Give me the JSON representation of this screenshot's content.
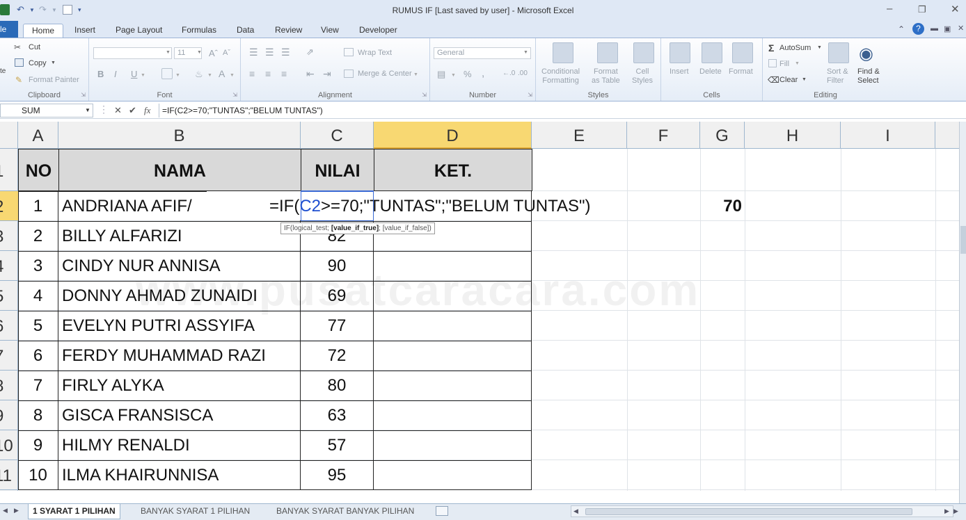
{
  "window": {
    "title": "RUMUS IF [Last saved by user]  -  Microsoft Excel",
    "minimize": "–",
    "restore": "❐",
    "close": "✕"
  },
  "ribbon_tabs": {
    "file": "le",
    "home": "Home",
    "insert": "Insert",
    "page_layout": "Page Layout",
    "formulas": "Formulas",
    "data": "Data",
    "review": "Review",
    "view": "View",
    "developer": "Developer"
  },
  "clipboard": {
    "cut": "Cut",
    "copy": "Copy",
    "format_painter": "Format Painter",
    "paste": "te",
    "label": "Clipboard"
  },
  "font": {
    "size": "11",
    "bold": "B",
    "italic": "I",
    "underline": "U",
    "label": "Font"
  },
  "alignment": {
    "wrap_text": "Wrap Text",
    "merge_center": "Merge & Center",
    "label": "Alignment"
  },
  "number": {
    "format": "General",
    "percent": "%",
    "label": "Number"
  },
  "styles": {
    "conditional_formatting": "Conditional\nFormatting",
    "format_as_table": "Format\nas Table",
    "cell_styles": "Cell\nStyles",
    "label": "Styles"
  },
  "cells": {
    "insert": "Insert",
    "delete": "Delete",
    "format": "Format",
    "label": "Cells"
  },
  "editing": {
    "autosum": "AutoSum",
    "fill": "Fill",
    "clear": "Clear",
    "sort_filter": "Sort &\nFilter",
    "find_select": "Find &\nSelect",
    "label": "Editing"
  },
  "formula_bar": {
    "name_box": "SUM",
    "cancel": "✕",
    "enter": "✔",
    "fx": "fx",
    "formula": "=IF(C2>=70;\"TUNTAS\";\"BELUM TUNTAS\")"
  },
  "columns": [
    "A",
    "B",
    "C",
    "D",
    "E",
    "F",
    "G",
    "H",
    "I"
  ],
  "row_numbers": [
    "1",
    "2",
    "3",
    "4",
    "5",
    "6",
    "7",
    "8",
    "9",
    "10",
    "11"
  ],
  "table_header": {
    "no": "NO",
    "nama": "NAMA",
    "nilai": "NILAI",
    "ket": "KET."
  },
  "rows": [
    {
      "no": "1",
      "nama": "ANDRIANA AFIF/",
      "nilai": ""
    },
    {
      "no": "2",
      "nama": "BILLY ALFARIZI",
      "nilai": "82"
    },
    {
      "no": "3",
      "nama": "CINDY NUR ANNISA",
      "nilai": "90"
    },
    {
      "no": "4",
      "nama": "DONNY AHMAD ZUNAIDI",
      "nilai": "69"
    },
    {
      "no": "5",
      "nama": "EVELYN PUTRI ASSYIFA",
      "nilai": "77"
    },
    {
      "no": "6",
      "nama": "FERDY MUHAMMAD RAZI",
      "nilai": "72"
    },
    {
      "no": "7",
      "nama": "FIRLY ALYKA",
      "nilai": "80"
    },
    {
      "no": "8",
      "nama": "GISCA FRANSISCA",
      "nilai": "63"
    },
    {
      "no": "9",
      "nama": "HILMY RENALDI",
      "nilai": "57"
    },
    {
      "no": "10",
      "nama": "ILMA KHAIRUNNISA",
      "nilai": "95"
    }
  ],
  "editing_cell": {
    "prefix": "=IF(",
    "ref": "C2",
    "suffix": ">=70;\"TUNTAS\";\"BELUM TUNTAS\")"
  },
  "g2_value": "70",
  "tooltip": {
    "part1": "IF(logical_test; ",
    "part2": "[value_if_true]",
    "part3": "; [value_if_false])"
  },
  "watermark": "www.pusatcaracara.com",
  "sheet_tabs": {
    "tab1": "1 SYARAT 1 PILIHAN",
    "tab2": "BANYAK SYARAT 1 PILIHAN",
    "tab3": "BANYAK SYARAT BANYAK PILIHAN"
  },
  "colors": {
    "selected_header": "#f8d872",
    "table_header_fill": "#d9d9d9",
    "cell_ref_blue": "#1f4fd0",
    "ribbon_bg": "#dfe8f5"
  }
}
